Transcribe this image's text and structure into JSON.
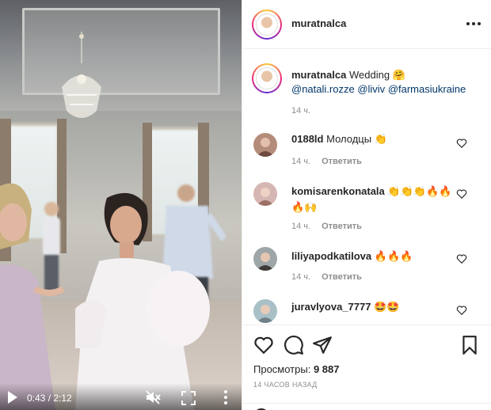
{
  "video": {
    "time_display": "0:43 / 2:12"
  },
  "post": {
    "username": "muratnalca",
    "caption_text": "Wedding 🤗",
    "caption_mentions": [
      "@natali.rozze",
      "@liviv",
      "@farmasiukraine"
    ],
    "caption_time": "14 ч."
  },
  "comments": [
    {
      "username": "0188ld",
      "text": "Молодцы 👏",
      "time": "14 ч.",
      "reply_label": "Ответить"
    },
    {
      "username": "komisarenkonatala",
      "text": "👏👏👏🔥🔥🔥🙌",
      "time": "14 ч.",
      "reply_label": "Ответить"
    },
    {
      "username": "liliyapodkatilova",
      "text": "🔥🔥🔥",
      "time": "14 ч.",
      "reply_label": "Ответить"
    },
    {
      "username": "juravlyova_7777",
      "text": "🤩🤩",
      "time": "",
      "reply_label": ""
    }
  ],
  "stats": {
    "views_label": "Просмотры:",
    "views_count": "9 887",
    "posted_ago": "14 часов назад"
  },
  "icons": {
    "play": "play-icon",
    "mute": "speaker-muted-icon",
    "fullscreen": "fullscreen-icon",
    "more": "more-vertical-icon",
    "options": "more-horizontal-icon",
    "like": "heart-icon",
    "comment": "comment-icon",
    "share": "paper-plane-icon",
    "save": "bookmark-icon"
  }
}
